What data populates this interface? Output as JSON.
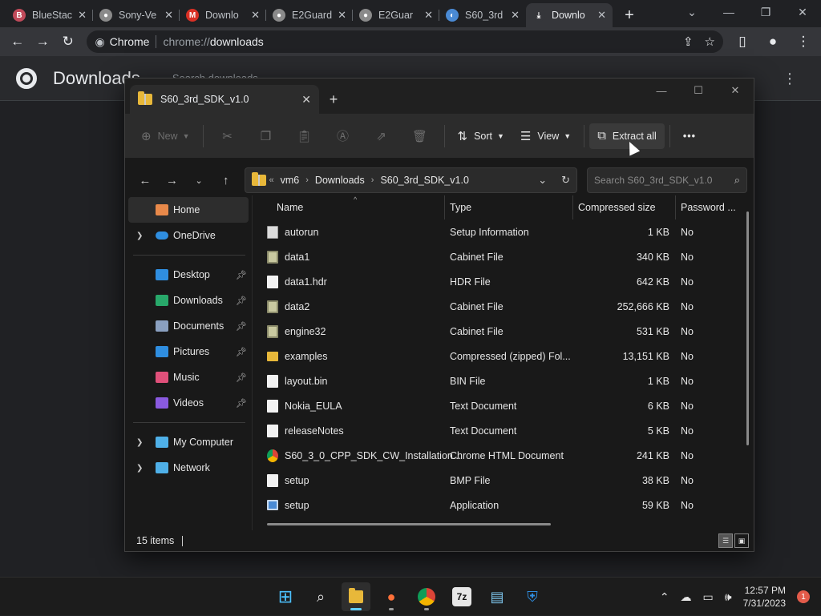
{
  "browser": {
    "tabs": [
      {
        "label": "BlueStac",
        "favicon_color": "#c04a5a",
        "favicon_glyph": "B"
      },
      {
        "label": "Sony-Ve",
        "favicon_color": "#8a8a8a",
        "favicon_glyph": "●"
      },
      {
        "label": "Downlo",
        "favicon_color": "#d93025",
        "favicon_glyph": "M"
      },
      {
        "label": "E2Guard",
        "favicon_color": "#8a8a8a",
        "favicon_glyph": "●"
      },
      {
        "label": "E2Guar",
        "favicon_color": "#8a8a8a",
        "favicon_glyph": "●"
      },
      {
        "label": "S60_3rd",
        "favicon_color": "#4a8ad4",
        "favicon_glyph": "◐"
      },
      {
        "label": "Downlo",
        "favicon_color": "#35363a",
        "favicon_glyph": "⤓"
      }
    ],
    "omnibox": {
      "site": "Chrome",
      "url_prefix": "chrome://",
      "url_rest": "downloads"
    }
  },
  "downloads_page": {
    "title": "Downloads",
    "search_placeholder": "Search downloads"
  },
  "explorer": {
    "tab_title": "S60_3rd_SDK_v1.0",
    "commands": {
      "new": "New",
      "sort": "Sort",
      "view": "View",
      "extract_all": "Extract all",
      "more": "•••"
    },
    "breadcrumb": [
      "vm6",
      "Downloads",
      "S60_3rd_SDK_v1.0"
    ],
    "search_placeholder": "Search S60_3rd_SDK_v1.0",
    "nav": {
      "home": "Home",
      "onedrive": "OneDrive",
      "quick": [
        "Desktop",
        "Downloads",
        "Documents",
        "Pictures",
        "Music",
        "Videos"
      ],
      "my_computer": "My Computer",
      "network": "Network"
    },
    "columns": {
      "name": "Name",
      "type": "Type",
      "size": "Compressed size",
      "password": "Password ..."
    },
    "files": [
      {
        "name": "autorun",
        "type": "Setup Information",
        "size": "1 KB",
        "password": "No",
        "icon": "setup"
      },
      {
        "name": "data1",
        "type": "Cabinet File",
        "size": "340 KB",
        "password": "No",
        "icon": "cab"
      },
      {
        "name": "data1.hdr",
        "type": "HDR File",
        "size": "642 KB",
        "password": "No",
        "icon": "doc"
      },
      {
        "name": "data2",
        "type": "Cabinet File",
        "size": "252,666 KB",
        "password": "No",
        "icon": "cab"
      },
      {
        "name": "engine32",
        "type": "Cabinet File",
        "size": "531 KB",
        "password": "No",
        "icon": "cab"
      },
      {
        "name": "examples",
        "type": "Compressed (zipped) Fol...",
        "size": "13,151 KB",
        "password": "No",
        "icon": "folder"
      },
      {
        "name": "layout.bin",
        "type": "BIN File",
        "size": "1 KB",
        "password": "No",
        "icon": "doc"
      },
      {
        "name": "Nokia_EULA",
        "type": "Text Document",
        "size": "6 KB",
        "password": "No",
        "icon": "doc"
      },
      {
        "name": "releaseNotes",
        "type": "Text Document",
        "size": "5 KB",
        "password": "No",
        "icon": "doc"
      },
      {
        "name": "S60_3_0_CPP_SDK_CW_Installation...",
        "type": "Chrome HTML Document",
        "size": "241 KB",
        "password": "No",
        "icon": "chrome"
      },
      {
        "name": "setup",
        "type": "BMP File",
        "size": "38 KB",
        "password": "No",
        "icon": "bmp"
      },
      {
        "name": "setup",
        "type": "Application",
        "size": "59 KB",
        "password": "No",
        "icon": "app"
      }
    ],
    "status": "15 items"
  },
  "taskbar": {
    "time": "12:57 PM",
    "date": "7/31/2023",
    "notification_count": "1"
  }
}
